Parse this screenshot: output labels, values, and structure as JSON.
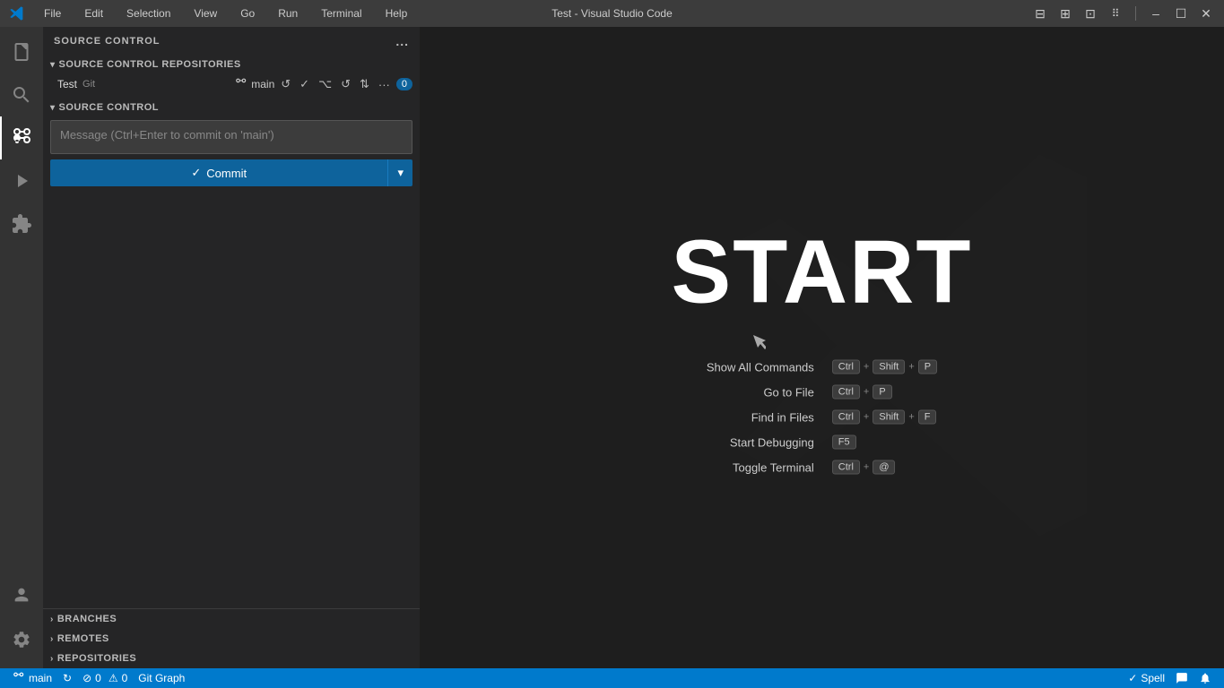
{
  "titlebar": {
    "title": "Test - Visual Studio Code",
    "menus": [
      "File",
      "Edit",
      "Selection",
      "View",
      "Go",
      "Run",
      "Terminal",
      "Help"
    ]
  },
  "activity_bar": {
    "icons": [
      {
        "name": "explorer-icon",
        "symbol": "📄",
        "tooltip": "Explorer"
      },
      {
        "name": "search-icon",
        "symbol": "🔍",
        "tooltip": "Search"
      },
      {
        "name": "source-control-icon",
        "symbol": "⎇",
        "tooltip": "Source Control",
        "active": true
      },
      {
        "name": "run-debug-icon",
        "symbol": "▶",
        "tooltip": "Run and Debug"
      },
      {
        "name": "extensions-icon",
        "symbol": "⊞",
        "tooltip": "Extensions"
      }
    ],
    "bottom": [
      {
        "name": "account-icon",
        "symbol": "👤",
        "tooltip": "Account"
      },
      {
        "name": "settings-icon",
        "symbol": "⚙",
        "tooltip": "Settings"
      }
    ]
  },
  "sidebar": {
    "title": "SOURCE CONTROL",
    "more_actions_label": "...",
    "repositories_section": {
      "label": "SOURCE CONTROL REPOSITORIES",
      "repo": {
        "name": "Test",
        "type": "Git",
        "branch": "main",
        "badge": "0"
      }
    },
    "source_control_section": {
      "label": "SOURCE CONTROL",
      "message_placeholder": "Message (Ctrl+Enter to commit on 'main')",
      "commit_label": "Commit",
      "commit_icon": "✓"
    },
    "bottom_sections": [
      {
        "label": "BRANCHES"
      },
      {
        "label": "REMOTES"
      },
      {
        "label": "REPOSITORIES"
      }
    ]
  },
  "editor": {
    "start_text": "START",
    "shortcuts": [
      {
        "label": "Show All Commands",
        "keys": [
          "Ctrl",
          "+",
          "Shift",
          "+",
          "P"
        ]
      },
      {
        "label": "Go to File",
        "keys": [
          "Ctrl",
          "+",
          "P"
        ]
      },
      {
        "label": "Find in Files",
        "keys": [
          "Ctrl",
          "+",
          "Shift",
          "+",
          "F"
        ]
      },
      {
        "label": "Start Debugging",
        "keys": [
          "F5"
        ]
      },
      {
        "label": "Toggle Terminal",
        "keys": [
          "Ctrl",
          "+",
          "@"
        ]
      }
    ]
  },
  "statusbar": {
    "branch": "main",
    "sync_icon": "↻",
    "errors": "0",
    "warnings": "0",
    "git_graph": "Git Graph",
    "spell": "Spell",
    "notifications": ""
  }
}
